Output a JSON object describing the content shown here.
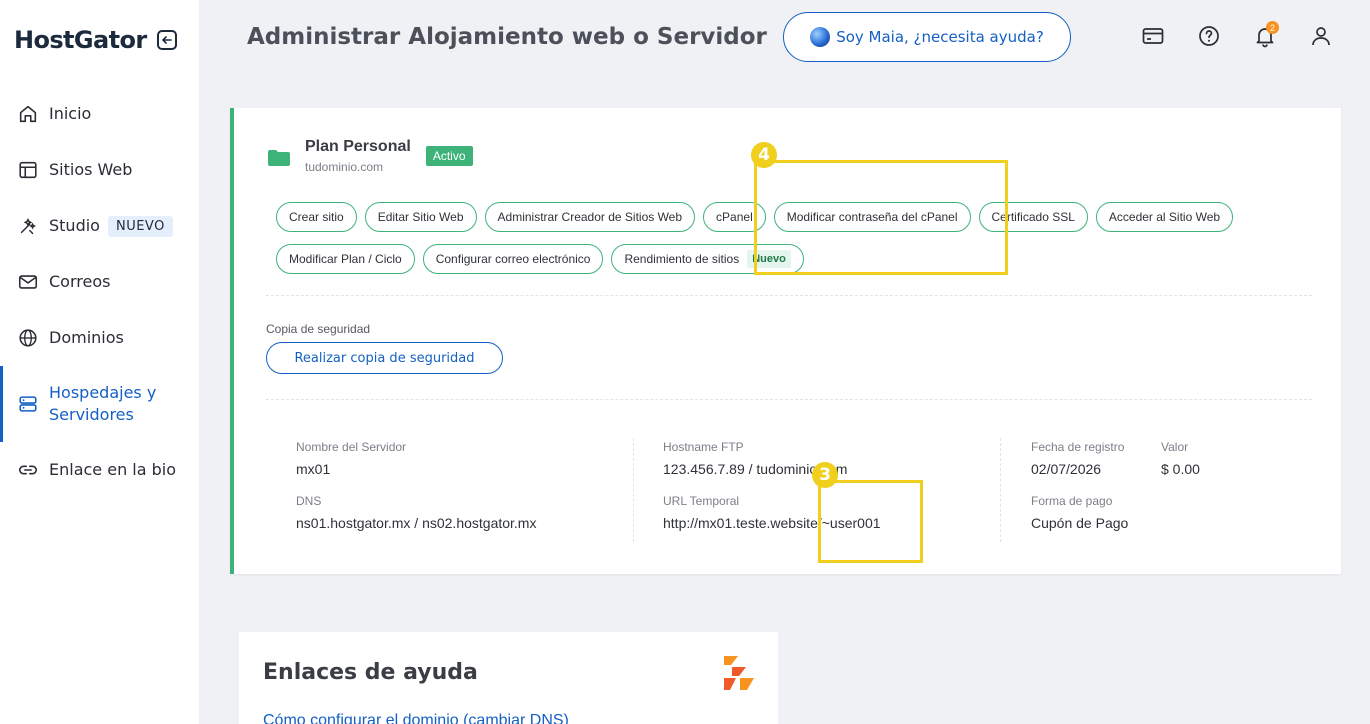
{
  "brand": {
    "logo": "HostGator",
    "collapse_icon": "arrow-left-icon"
  },
  "sidebar": {
    "items": [
      {
        "label": "Inicio",
        "icon": "home-icon"
      },
      {
        "label": "Sitios Web",
        "icon": "layout-icon"
      },
      {
        "label": "Studio",
        "icon": "wand-icon",
        "badge": "NUEVO"
      },
      {
        "label": "Correos",
        "icon": "mail-icon"
      },
      {
        "label": "Dominios",
        "icon": "globe-icon"
      },
      {
        "label_line1": "Hospedajes y",
        "label_line2": "Servidores",
        "icon": "server-icon",
        "active": true
      },
      {
        "label": "Enlace en la bio",
        "icon": "link-icon"
      }
    ]
  },
  "header": {
    "title": "Administrar Alojamiento web o Servidor",
    "assistant_button": "Soy Maia, ¿necesita ayuda?",
    "icons": [
      "card-icon",
      "help-icon",
      "bell-icon",
      "user-icon"
    ],
    "notification_count": "2"
  },
  "plan": {
    "name": "Plan Personal",
    "domain": "tudominio.com",
    "status": "Activo",
    "actions_row1": [
      "Crear sitio",
      "Editar Sitio Web",
      "Administrar Creador de Sitios Web",
      "cPanel",
      "Modificar contraseña del cPanel",
      "Certificado SSL",
      "Acceder al Sitio Web"
    ],
    "actions_row2": [
      "Modificar Plan / Ciclo",
      "Configurar correo electrónico",
      "Rendimiento de sitios"
    ],
    "new_tag": "Nuevo",
    "backup_label": "Copia de seguridad",
    "backup_button": "Realizar copia de seguridad"
  },
  "server_info": {
    "server_name_label": "Nombre del Servidor",
    "server_name": "mx01",
    "dns_label": "DNS",
    "dns": "ns01.hostgator.mx / ns02.hostgator.mx",
    "ftp_label": "Hostname FTP",
    "ftp": "123.456.7.89 / tudominio.com",
    "temp_url_label": "URL Temporal",
    "temp_url": "http://mx01.teste.website/~user001",
    "reg_date_label": "Fecha de registro",
    "reg_date": "02/07/2026",
    "value_label": "Valor",
    "value": "$ 0.00",
    "payment_label": "Forma de pago",
    "payment": "Cupón de Pago"
  },
  "help": {
    "title": "Enlaces de ayuda",
    "link1": "Cómo configurar el dominio (cambiar DNS)"
  },
  "annotations": {
    "marker_4": "4",
    "marker_3": "3",
    "color": "#f0cf1d"
  },
  "colors": {
    "accent": "#1460c4",
    "green": "#3db37a",
    "orange": "#f7931e"
  }
}
